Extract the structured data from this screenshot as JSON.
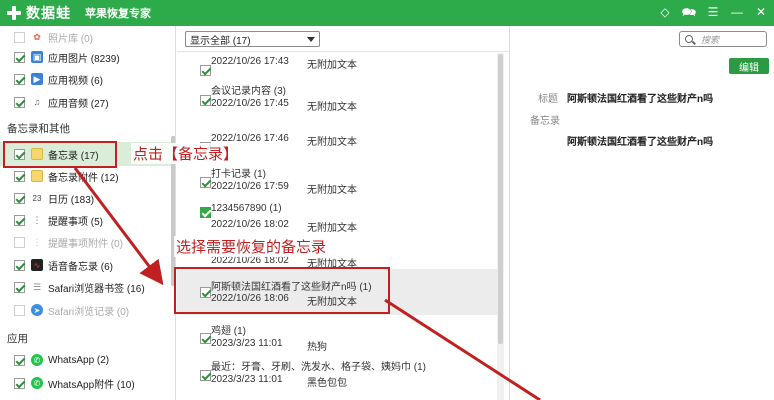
{
  "titlebar": {
    "brand": "数据蛙",
    "product": "苹果恢复专家",
    "icons": [
      "diamond-icon",
      "chat-icon",
      "menu-icon",
      "minimize-icon",
      "close-icon"
    ]
  },
  "sidebar": {
    "top_items": [
      {
        "label": "照片库 (0)",
        "checked": false,
        "dim": true,
        "icon": "photo-library-icon"
      },
      {
        "label": "应用图片 (8239)",
        "checked": true,
        "dim": false,
        "icon": "app-image-icon"
      },
      {
        "label": "应用视频 (6)",
        "checked": true,
        "dim": false,
        "icon": "app-video-icon"
      },
      {
        "label": "应用音频 (27)",
        "checked": true,
        "dim": false,
        "icon": "app-audio-icon"
      }
    ],
    "section_memo": "备忘录和其他",
    "memo_items": [
      {
        "label": "备忘录 (17)",
        "checked": true,
        "dim": false,
        "icon": "notes-icon"
      },
      {
        "label": "备忘录附件 (12)",
        "checked": true,
        "dim": false,
        "icon": "notes-attachment-icon"
      },
      {
        "label": "日历 (183)",
        "checked": true,
        "dim": false,
        "icon": "calendar-icon"
      },
      {
        "label": "提醒事项 (5)",
        "checked": true,
        "dim": false,
        "icon": "reminders-icon"
      },
      {
        "label": "提醒事项附件 (0)",
        "checked": false,
        "dim": true,
        "icon": "reminders-attachment-icon"
      },
      {
        "label": "语音备忘录 (6)",
        "checked": true,
        "dim": false,
        "icon": "voice-memo-icon"
      },
      {
        "label": "Safari浏览器书签 (16)",
        "checked": true,
        "dim": false,
        "icon": "safari-bookmark-icon"
      },
      {
        "label": "Safari浏览记录 (0)",
        "checked": false,
        "dim": true,
        "icon": "safari-history-icon"
      }
    ],
    "section_apps": "应用",
    "app_items": [
      {
        "label": "WhatsApp (2)",
        "checked": true,
        "dim": false,
        "icon": "whatsapp-icon"
      },
      {
        "label": "WhatsApp附件 (10)",
        "checked": true,
        "dim": false,
        "icon": "whatsapp-attachment-icon"
      }
    ]
  },
  "middle": {
    "filter_value": "显示全部 (17)",
    "items": [
      {
        "title": "",
        "date": "2022/10/26 17:43",
        "tag": "无附加文本",
        "checked": true,
        "green": false
      },
      {
        "title": "会议记录内容 (3)",
        "date": "2022/10/26 17:45",
        "tag": "无附加文本",
        "checked": true,
        "green": false
      },
      {
        "title": "",
        "date": "2022/10/26 17:46",
        "tag": "无附加文本",
        "checked": true,
        "green": false
      },
      {
        "title": "打卡记录 (1)",
        "date": "2022/10/26 17:59",
        "tag": "无附加文本",
        "checked": true,
        "green": false
      },
      {
        "title": "1234567890 (1)",
        "date": "2022/10/26 18:02",
        "tag": "无附加文本",
        "checked": true,
        "green": true
      },
      {
        "title": "",
        "date": "2022/10/26 18:02",
        "tag": "无附加文本",
        "checked": true,
        "green": false
      },
      {
        "title": "阿斯顿法国红酒看了这些财产n吗 (1)",
        "date": "2022/10/26 18:06",
        "tag": "无附加文本",
        "checked": true,
        "green": false
      },
      {
        "title": "鸡翅 (1)",
        "date": "2023/3/23 11:01",
        "tag": "热狗",
        "checked": true,
        "green": false
      },
      {
        "title": "最近：牙膏、牙刷、洗发水、格子袋、姨妈巾 (1)",
        "date": "2023/3/23 11:01",
        "tag": "黑色包包",
        "checked": true,
        "green": false
      }
    ]
  },
  "right": {
    "search_placeholder": "搜索",
    "edit_label": "编辑",
    "title_label": "标题",
    "title_value": "阿斯顿法国红酒看了这些财产n吗",
    "memo_label": "备忘录",
    "memo_value": "阿斯顿法国红酒看了这些财产n吗"
  },
  "annotations": {
    "click_memo": "点击【备忘录】",
    "select_memo": "选择需要恢复的备忘录",
    "color": "#c0201f"
  },
  "colors": {
    "brand_green": "#2daa4a",
    "selected_row": "#d9edd9",
    "edit_button": "#2c9a43"
  }
}
